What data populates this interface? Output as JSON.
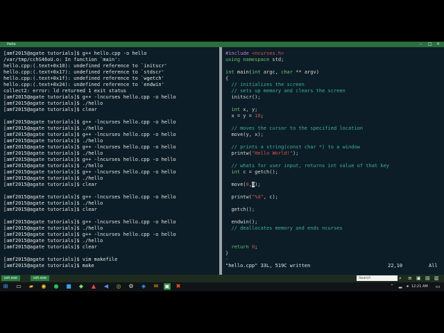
{
  "window": {
    "title": "Hello"
  },
  "left_terminal": {
    "lines": [
      "[amf2015@agate tutorials]$ g++ hello.cpp -o hello",
      "/var/tmp/cchS46oU.o: In function `main':",
      "hello.cpp:(.text+0x10): undefined reference to `initscr'",
      "hello.cpp:(.text+0x17): undefined reference to `stdscr'",
      "hello.cpp:(.text+0x1f): undefined reference to `wgetch'",
      "hello.cpp:(.text+0x24): undefined reference to `endwin'",
      "collect2: error: ld returned 1 exit status",
      "[amf2015@agate tutorials]$ g++ -lncurses hello.cpp -o hello",
      "[amf2015@agate tutorials]$ ./hello",
      "[amf2015@agate tutorials]$ clear",
      "",
      "[amf2015@agate tutorials]$ g++ -lncurses hello.cpp -o hello",
      "[amf2015@agate tutorials]$ ./hello",
      "[amf2015@agate tutorials]$ g++ -lncurses hello.cpp -o hello",
      "[amf2015@agate tutorials]$ ./hello",
      "[amf2015@agate tutorials]$ g++ -lncurses hello.cpp -o hello",
      "[amf2015@agate tutorials]$ ./hello",
      "[amf2015@agate tutorials]$ g++ -lncurses hello.cpp -o hello",
      "[amf2015@agate tutorials]$ ./hello",
      "[amf2015@agate tutorials]$ g++ -lncurses hello.cpp -o hello",
      "[amf2015@agate tutorials]$ ./hello",
      "[amf2015@agate tutorials]$ clear",
      "",
      "[amf2015@agate tutorials]$ g++ -lncurses hello.cpp -o hello",
      "[amf2015@agate tutorials]$ ./hello",
      "[amf2015@agate tutorials]$ clear",
      "",
      "[amf2015@agate tutorials]$ g++ -lncurses hello.cpp -o hello",
      "[amf2015@agate tutorials]$ ./hello",
      "[amf2015@agate tutorials]$ g++ -lncurses hello.cpp -o hello",
      "[amf2015@agate tutorials]$ ./hello",
      "[amf2015@agate tutorials]$ clear",
      "",
      "[amf2015@agate tutorials]$ vim makefile",
      "[amf2015@agate tutorials]$ make"
    ]
  },
  "editor": {
    "code": {
      "include_directive": "#include",
      "include_file": "<ncurses.h>",
      "using_kw": "using namespace",
      "using_rest": " std;",
      "int1": "int",
      "main_sig": " main(",
      "int2": "int",
      "main_args": " argc, ",
      "char_kw": "char",
      "main_args2": " ** argv)",
      "brace_open": "{",
      "c1": "// initializes the screen",
      "c2": "// sets up memory and clears the screen",
      "initscr": "initscr();",
      "int3": "int",
      "xy_decl": " x, y;",
      "assign": "x = y = ",
      "assign_num": "10",
      "assign_end": ";",
      "c3": "// moves the cursor to the specified location",
      "move1": "move(y, x);",
      "c4": "// prints a string(const char *) to a window",
      "printw1": "printw(",
      "printw1_str": "\"Hello World!\"",
      "printw1_end": ");",
      "c5": "// whats for user input, returns int value of that key",
      "int4": "int",
      "getch_decl": " c = getch();",
      "move2": "move(",
      "move2_a": "0",
      "move2_comma": ",",
      "move2_b": "0",
      "move2_end": ");",
      "printw2": "printw(",
      "printw2_str": "\"%d\"",
      "printw2_end": ", c);",
      "getch2": "getch();",
      "endwin": "endwin();",
      "c6": "// deallocates memory and ends ncurses",
      "return_kw": "return ",
      "return_num": "0",
      "return_end": ";",
      "brace_close": "}",
      "tilde": "~"
    },
    "status": {
      "file": "\"hello.cpp\" 33L, 519C written",
      "position": "22,10",
      "scroll": "All"
    }
  },
  "statusbar": {
    "tab1": "ssh.exe",
    "tab2": "ssh.exe",
    "search_placeholder": "Search"
  },
  "taskbar": {
    "time": "12:21 AM"
  }
}
